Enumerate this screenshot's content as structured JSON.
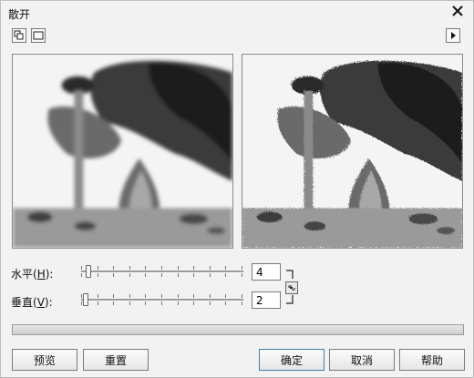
{
  "dialog": {
    "title": "散开",
    "close_icon": "close-icon"
  },
  "toolbar": {
    "split_view_icon": "split-view-icon",
    "single_view_icon": "single-view-icon",
    "expand_icon": "triangle-right-icon"
  },
  "previews": {
    "original_label": "",
    "result_label": ""
  },
  "controls": {
    "horizontal": {
      "label_prefix": "水平(",
      "label_key": "H",
      "label_suffix": "):",
      "value": "4",
      "slider_value": 4,
      "slider_max": 100
    },
    "vertical": {
      "label_prefix": "垂直(",
      "label_key": "V",
      "label_suffix": "):",
      "value": "2",
      "slider_value": 2,
      "slider_max": 100
    },
    "link_icon": "link-icon"
  },
  "buttons": {
    "preview": "预览",
    "reset": "重置",
    "ok": "确定",
    "cancel": "取消",
    "help": "帮助"
  },
  "colors": {
    "default_border": "#3c7fb1"
  }
}
